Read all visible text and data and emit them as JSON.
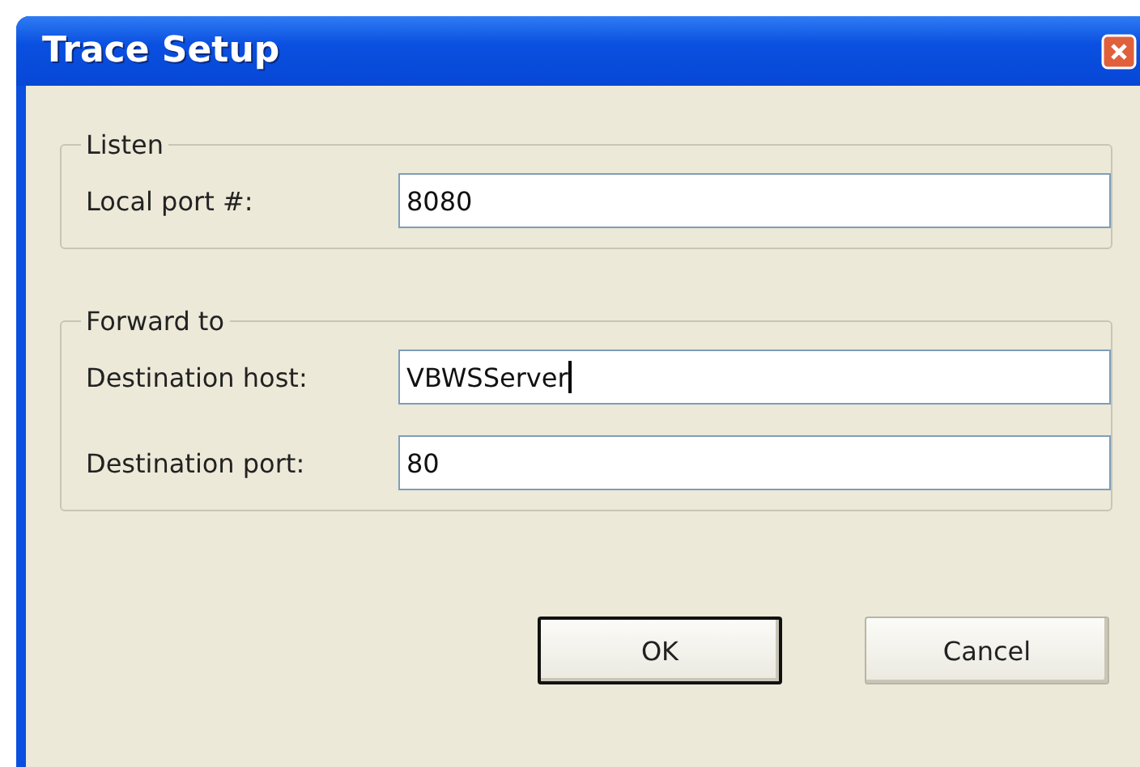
{
  "window": {
    "title": "Trace Setup"
  },
  "groups": [
    {
      "title": "Listen",
      "fields": [
        {
          "label": "Local port #:",
          "value": "8080",
          "focused": false
        }
      ]
    },
    {
      "title": "Forward to",
      "fields": [
        {
          "label": "Destination host:",
          "value": "VBWSServer",
          "focused": true
        },
        {
          "label": "Destination port:",
          "value": "80",
          "focused": false
        }
      ]
    }
  ],
  "buttons": [
    {
      "label": "OK",
      "default": true
    },
    {
      "label": "Cancel",
      "default": false
    }
  ]
}
